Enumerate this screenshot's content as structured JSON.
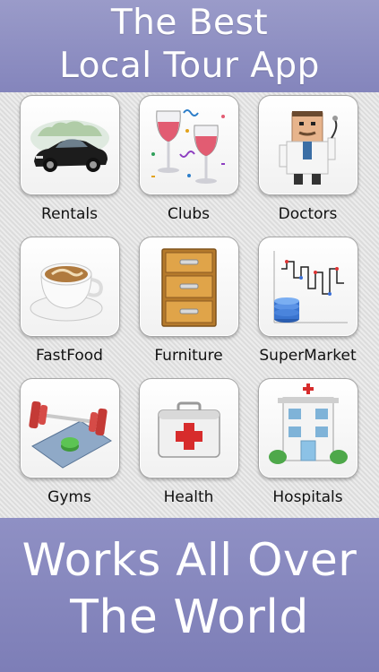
{
  "header": {
    "line1": "The Best",
    "line2": "Local Tour App"
  },
  "categories": [
    {
      "label": "Rentals",
      "icon": "car-icon"
    },
    {
      "label": "Clubs",
      "icon": "wine-glasses-icon"
    },
    {
      "label": "Doctors",
      "icon": "doctor-icon"
    },
    {
      "label": "FastFood",
      "icon": "coffee-cup-icon"
    },
    {
      "label": "Furniture",
      "icon": "drawer-cabinet-icon"
    },
    {
      "label": "SuperMarket",
      "icon": "stock-chart-icon"
    },
    {
      "label": "Gyms",
      "icon": "dumbbell-icon"
    },
    {
      "label": "Health",
      "icon": "first-aid-kit-icon"
    },
    {
      "label": "Hospitals",
      "icon": "hospital-building-icon"
    }
  ],
  "footer": {
    "line1": "Works All Over",
    "line2": "The World"
  },
  "colors": {
    "banner": "#8a8bc0",
    "banner_text": "#ffffff",
    "tile_border": "#a7a7a7"
  }
}
